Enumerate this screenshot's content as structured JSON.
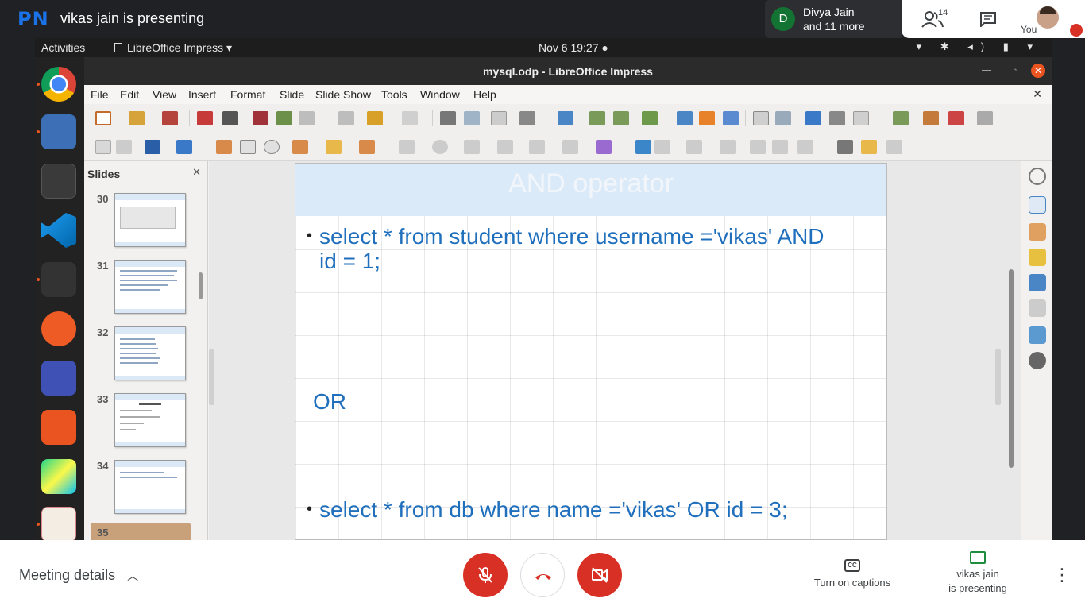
{
  "meet": {
    "logo": "PN",
    "presenter_title": "vikas jain is presenting",
    "participant_initial": "D",
    "participant_name": "Divya Jain",
    "participant_more": "and 11 more",
    "people_count": "14",
    "self_label": "You",
    "meeting_details": "Meeting details",
    "captions_label": "Turn on captions",
    "presenting_line1": "vikas jain",
    "presenting_line2": "is presenting",
    "colors": {
      "accent_red": "#d93025",
      "brand_blue": "#1a73e8",
      "present_green": "#1e8e3e"
    }
  },
  "desktop": {
    "activities": "Activities",
    "app_menu": "LibreOffice Impress ▾",
    "clock": "Nov 6  19:27 ●",
    "tray": "▾ ✱ ◂) ▮ ▾",
    "dock_icons": [
      "chrome-icon",
      "files-icon",
      "terminal-icon",
      "vscode-icon",
      "sublime-icon",
      "postman-icon",
      "screenshot-icon",
      "software-center-icon",
      "pycharm-icon",
      "impress-icon"
    ]
  },
  "impress": {
    "window_title": "mysql.odp - LibreOffice Impress",
    "menu": [
      "File",
      "Edit",
      "View",
      "Insert",
      "Format",
      "Slide",
      "Slide Show",
      "Tools",
      "Window",
      "Help"
    ],
    "slides_panel_title": "Slides",
    "thumbnails": [
      {
        "number": "30"
      },
      {
        "number": "31"
      },
      {
        "number": "32"
      },
      {
        "number": "33"
      },
      {
        "number": "34"
      },
      {
        "number": "35"
      }
    ],
    "selected_slide": "35",
    "slide": {
      "title": "AND operator",
      "bullet1_line1": "select * from student where username ='vikas' AND",
      "bullet1_line2": "id = 1;",
      "or_text": "OR",
      "bullet2": "select * from db where name ='vikas' OR id = 3;",
      "text_color": "#1f6fbd"
    }
  }
}
